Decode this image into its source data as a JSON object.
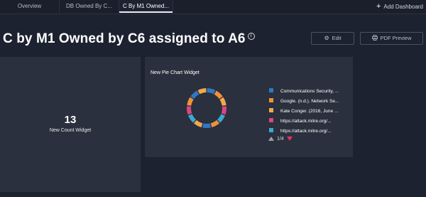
{
  "tabs": [
    {
      "label": "Overview"
    },
    {
      "label": "DB Owned By C..."
    },
    {
      "label": "C By M1 Owned..."
    }
  ],
  "active_tab_index": 2,
  "add_dashboard_label": "Add Dashboard",
  "page_title": "C by M1 Owned by C6 assigned to A6",
  "buttons": {
    "edit_label": "Edit",
    "pdf_preview_label": "PDF Preview"
  },
  "count_widget": {
    "value": "13",
    "label": "New Count Widget"
  },
  "pie_widget": {
    "title": "New Pie Chart Widget",
    "legend": [
      {
        "label": "Communications Security, ...",
        "color": "#2f78c5"
      },
      {
        "label": "Google. (n.d.). Network Se...",
        "color": "#f0913a"
      },
      {
        "label": "Kate Conger. (2016, June ...",
        "color": "#f3a94a"
      },
      {
        "label": "https://attack.mitre.org/...",
        "color": "#d9477f"
      },
      {
        "label": "https://attack.mitre.org/...",
        "color": "#3fa7cf"
      }
    ],
    "pager": "1/4"
  },
  "colors": {
    "background": "#1c2230",
    "panel": "#2a303d",
    "accent_down": "#e2365f"
  }
}
